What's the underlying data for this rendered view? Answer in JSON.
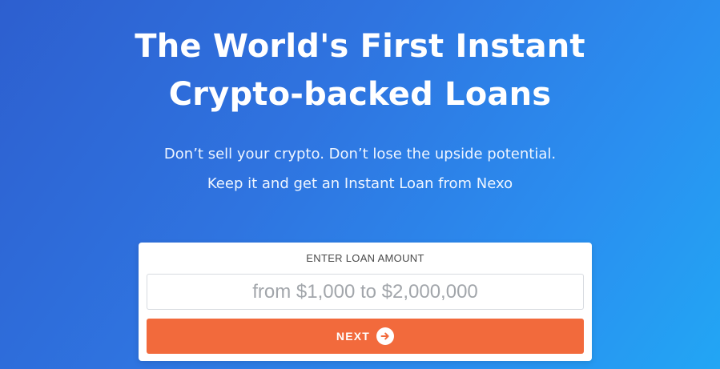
{
  "hero": {
    "title_lines": [
      "The World's First Instant",
      "Crypto-backed Loans"
    ],
    "subtitle_lines": [
      "Don’t sell your crypto. Don’t lose the upside potential.",
      "Keep it and get an Instant Loan from Nexo"
    ]
  },
  "loan_form": {
    "label": "ENTER LOAN AMOUNT",
    "amount_placeholder": "from $1,000 to $2,000,000",
    "amount_value": "",
    "next_label": "NEXT",
    "next_icon": "arrow-right-circle-icon"
  },
  "colors": {
    "background_start": "#2d5fcf",
    "background_end": "#22a6f4",
    "button": "#f26a3c",
    "card": "#ffffff"
  }
}
